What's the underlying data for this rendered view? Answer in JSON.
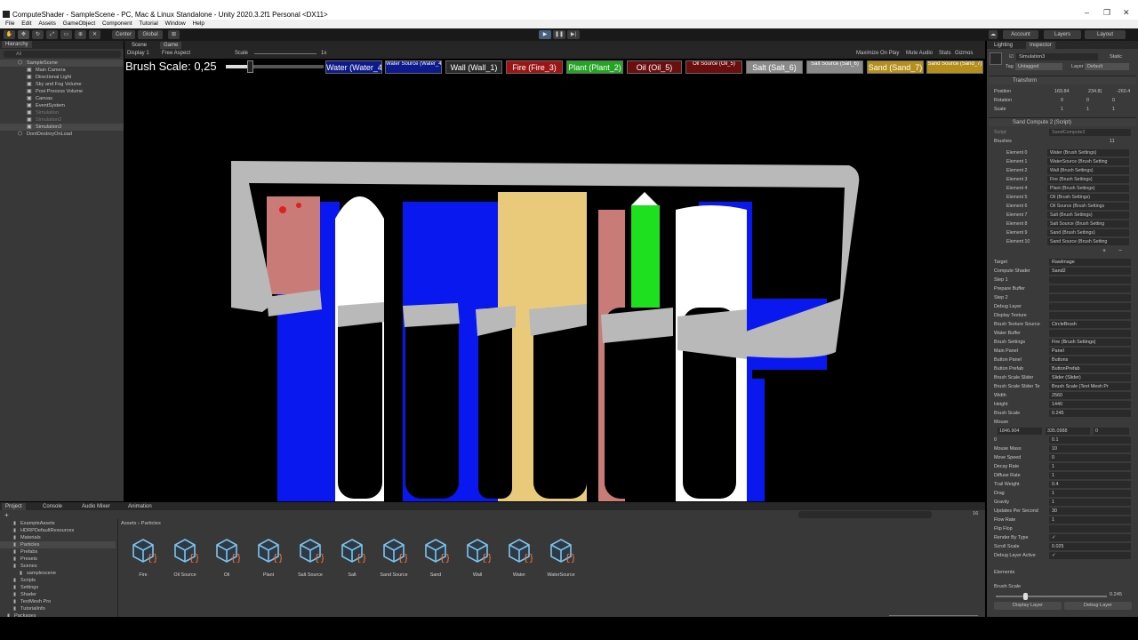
{
  "window": {
    "title": "ComputeShader - SampleScene - PC, Mac & Linux Standalone - Unity 2020.3.2f1 Personal <DX11>",
    "controls": [
      "–",
      "❐",
      "✕"
    ]
  },
  "menu": [
    "File",
    "Edit",
    "Assets",
    "GameObject",
    "Component",
    "Tutorial",
    "Window",
    "Help"
  ],
  "toolbar": {
    "pivot": "Center",
    "space": "Global",
    "account": "Account",
    "layers": "Layers",
    "layout": "Layout"
  },
  "hierarchy": {
    "tab": "Hierarchy",
    "search_placeholder": "All",
    "items": [
      {
        "label": "SampleScene",
        "indent": 0,
        "selected": true
      },
      {
        "label": "Main Camera",
        "indent": 1
      },
      {
        "label": "Directional Light",
        "indent": 1
      },
      {
        "label": "Sky and Fog Volume",
        "indent": 1
      },
      {
        "label": "Post Process Volume",
        "indent": 1
      },
      {
        "label": "Canvas",
        "indent": 1
      },
      {
        "label": "EventSystem",
        "indent": 1
      },
      {
        "label": "Simulation",
        "indent": 1,
        "disabled": true
      },
      {
        "label": "Simulation2",
        "indent": 1,
        "disabled": true
      },
      {
        "label": "Simulation3",
        "indent": 1,
        "selected": true
      },
      {
        "label": "DontDestroyOnLoad",
        "indent": 0
      }
    ]
  },
  "game": {
    "tabs": [
      "Scene",
      "Game"
    ],
    "display": "Display 1",
    "aspect": "Free Aspect",
    "scale_label": "Scale",
    "scale_value": "1x",
    "options": [
      "Maximize On Play",
      "Mute Audio",
      "Stats",
      "Gizmos"
    ],
    "brush_scale_label": "Brush Scale: 0,25",
    "brush_scale_fraction": 0.245,
    "brushes": [
      {
        "label": "Water (Water_4)",
        "color": "#0d1a8c",
        "small": false
      },
      {
        "label": "Water Source (Water_4)",
        "color": "#0d1a8c",
        "small": true
      },
      {
        "label": "Wall (Wall_1)",
        "color": "#2a2a2a",
        "small": false
      },
      {
        "label": "Fire (Fire_3)",
        "color": "#9c1414",
        "small": false
      },
      {
        "label": "Plant (Plant_2)",
        "color": "#23a423",
        "small": false
      },
      {
        "label": "Oil (Oil_5)",
        "color": "#6b0e0e",
        "small": false
      },
      {
        "label": "Oil Source (Oil_5)",
        "color": "#6b0e0e",
        "small": true
      },
      {
        "label": "Salt (Salt_6)",
        "color": "#8a8a8a",
        "small": false
      },
      {
        "label": "Salt Source (Salt_6)",
        "color": "#8a8a8a",
        "small": true
      },
      {
        "label": "Sand (Sand_7)",
        "color": "#b58f1c",
        "small": false
      },
      {
        "label": "Sand Source (Sand_7)",
        "color": "#b58f1c",
        "small": true
      }
    ]
  },
  "inspector": {
    "tabs": [
      "Lighting",
      "Inspector"
    ],
    "object_name": "Simulation3",
    "static_label": "Static",
    "tag": "Untagged",
    "layer": "Default",
    "transform": {
      "title": "Transform",
      "position": {
        "label": "Position",
        "x": "169.84",
        "y": "234.8(",
        "z": "-260.4"
      },
      "rotation": {
        "label": "Rotation",
        "x": "0",
        "y": "0",
        "z": "0"
      },
      "scale": {
        "label": "Scale",
        "x": "1",
        "y": "1",
        "z": "1"
      }
    },
    "script": {
      "title": "Sand Compute 2 (Script)",
      "script_label": "Script",
      "script_value": "SandCompute2",
      "brushes_label": "Brushes",
      "brushes_count": "11",
      "elements": [
        {
          "label": "Element 0",
          "value": "Water (Brush Settings)"
        },
        {
          "label": "Element 1",
          "value": "WaterSource (Brush Setting"
        },
        {
          "label": "Element 2",
          "value": "Wall (Brush Settings)"
        },
        {
          "label": "Element 3",
          "value": "Fire (Brush Settings)"
        },
        {
          "label": "Element 4",
          "value": "Plant (Brush Settings)"
        },
        {
          "label": "Element 5",
          "value": "Oil (Brush Settings)"
        },
        {
          "label": "Element 6",
          "value": "Oil Source (Brush Settings"
        },
        {
          "label": "Element 7",
          "value": "Salt (Brush Settings)"
        },
        {
          "label": "Element 8",
          "value": "Salt Source (Brush Setting"
        },
        {
          "label": "Element 9",
          "value": "Sand (Brush Settings)"
        },
        {
          "label": "Element 10",
          "value": "Sand Source (Brush Setting"
        }
      ],
      "fields": [
        {
          "label": "Target",
          "value": "RawImage"
        },
        {
          "label": "Compute Shader",
          "value": "Sand2"
        },
        {
          "label": "Step 1",
          "value": ""
        },
        {
          "label": "Prepare Buffer",
          "value": ""
        },
        {
          "label": "Step 2",
          "value": ""
        },
        {
          "label": "Debug Layer",
          "value": ""
        },
        {
          "label": "Display Texture",
          "value": ""
        },
        {
          "label": "Brush Texture Source",
          "value": "CircleBrush"
        },
        {
          "label": "Water Buffer",
          "value": ""
        },
        {
          "label": "Brush Settings",
          "value": "Fire (Brush Settings)"
        },
        {
          "label": "Main Panel",
          "value": "Panel"
        },
        {
          "label": "Button Panel",
          "value": "Buttons"
        },
        {
          "label": "Button Prefab",
          "value": "ButtonPrefab"
        },
        {
          "label": "Brush Scale Slider",
          "value": "Slider (Slider)"
        },
        {
          "label": "Brush Scale Slider Te",
          "value": "Brush Scale (Text Mesh Pr"
        },
        {
          "label": "Width",
          "value": "2560"
        },
        {
          "label": "Height",
          "value": "1440"
        },
        {
          "label": "Brush Scale",
          "value": "0.245"
        }
      ],
      "mouse_label": "Mouse",
      "mouse": {
        "x": "1846.904",
        "y": "335.0988",
        "z": "0"
      },
      "fields2": [
        {
          "label": "0",
          "value": "0.1"
        },
        {
          "label": "Mouse Mass",
          "value": "10"
        },
        {
          "label": "Move Speed",
          "value": "0"
        },
        {
          "label": "Decay Rate",
          "value": "1"
        },
        {
          "label": "Diffuse Rate",
          "value": "1"
        },
        {
          "label": "Trail Weight",
          "value": "0.4"
        },
        {
          "label": "Drag",
          "value": "1"
        },
        {
          "label": "Gravity",
          "value": "1"
        },
        {
          "label": "Updates Per Second",
          "value": "30"
        },
        {
          "label": "Flow Rate",
          "value": "1"
        },
        {
          "label": "Flip Flop",
          "value": ""
        },
        {
          "label": "Render By Type",
          "value": "✓"
        },
        {
          "label": "Scroll Scale",
          "value": "0.025"
        },
        {
          "label": "Debug Layer Active",
          "value": "✓"
        }
      ],
      "elements_label": "Elements",
      "slider_label": "Brush Scale",
      "slider_value": "0.245",
      "buttons": [
        "Display Layer",
        "Debug Layer"
      ]
    }
  },
  "project": {
    "tabs": [
      "Project",
      "Console",
      "Audio Mixer",
      "Animation"
    ],
    "breadcrumb": [
      "Assets",
      "Particles"
    ],
    "tree": [
      {
        "label": "ExampleAssets",
        "indent": 1
      },
      {
        "label": "HDRPDefaultResources",
        "indent": 1
      },
      {
        "label": "Materials",
        "indent": 1
      },
      {
        "label": "Particles",
        "indent": 1,
        "selected": true
      },
      {
        "label": "Prefabs",
        "indent": 1
      },
      {
        "label": "Presets",
        "indent": 1
      },
      {
        "label": "Scenes",
        "indent": 1
      },
      {
        "label": "samplescene",
        "indent": 2
      },
      {
        "label": "Scripts",
        "indent": 1
      },
      {
        "label": "Settings",
        "indent": 1
      },
      {
        "label": "Shader",
        "indent": 1
      },
      {
        "label": "TextMesh Pro",
        "indent": 1
      },
      {
        "label": "TutorialInfo",
        "indent": 1
      },
      {
        "label": "Packages",
        "indent": 0
      }
    ],
    "assets": [
      "Fire",
      "Oil Source",
      "Oil",
      "Plant",
      "Salt Source",
      "Salt",
      "Sand Source",
      "Sand",
      "Wall",
      "Water",
      "WaterSource"
    ],
    "count": "16"
  },
  "colors": {
    "water": "#0a18f0",
    "wall": "#b9b9b9",
    "sand": "#e9c97a",
    "oil": "#c97b78",
    "plant": "#1fe01f",
    "fire": "#e02020",
    "salt": "#ffffff"
  }
}
